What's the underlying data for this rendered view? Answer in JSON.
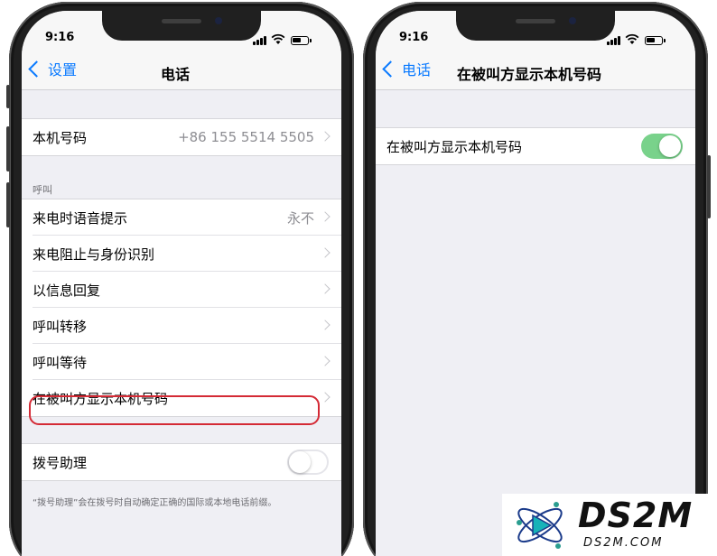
{
  "left_phone": {
    "status_time": "9:16",
    "nav_back_label": "设置",
    "nav_title": "电话",
    "my_number": {
      "label": "本机号码",
      "value": "+86 155 5514 5505"
    },
    "calls_section_header": "呼叫",
    "call_rows": [
      {
        "label": "来电时语音提示",
        "value": "永不"
      },
      {
        "label": "来电阻止与身份识别",
        "value": ""
      },
      {
        "label": "以信息回复",
        "value": ""
      },
      {
        "label": "呼叫转移",
        "value": ""
      },
      {
        "label": "呼叫等待",
        "value": ""
      },
      {
        "label": "在被叫方显示本机号码",
        "value": ""
      }
    ],
    "dial_assist": {
      "label": "拨号助理",
      "enabled": false
    },
    "dial_assist_footnote": "“拨号助理”会在拨号时自动确定正确的国际或本地电话前缀。"
  },
  "right_phone": {
    "status_time": "9:16",
    "nav_back_label": "电话",
    "nav_title": "在被叫方显示本机号码",
    "show_caller_id": {
      "label": "在被叫方显示本机号码",
      "enabled": true
    }
  },
  "watermark": {
    "title": "DS2M",
    "subtitle": "DS2M.COM"
  },
  "colors": {
    "ios_blue": "#0a7aff",
    "toggle_on": "#79d28b",
    "highlight_red": "#d42a35",
    "grouped_bg": "#efeff4"
  }
}
